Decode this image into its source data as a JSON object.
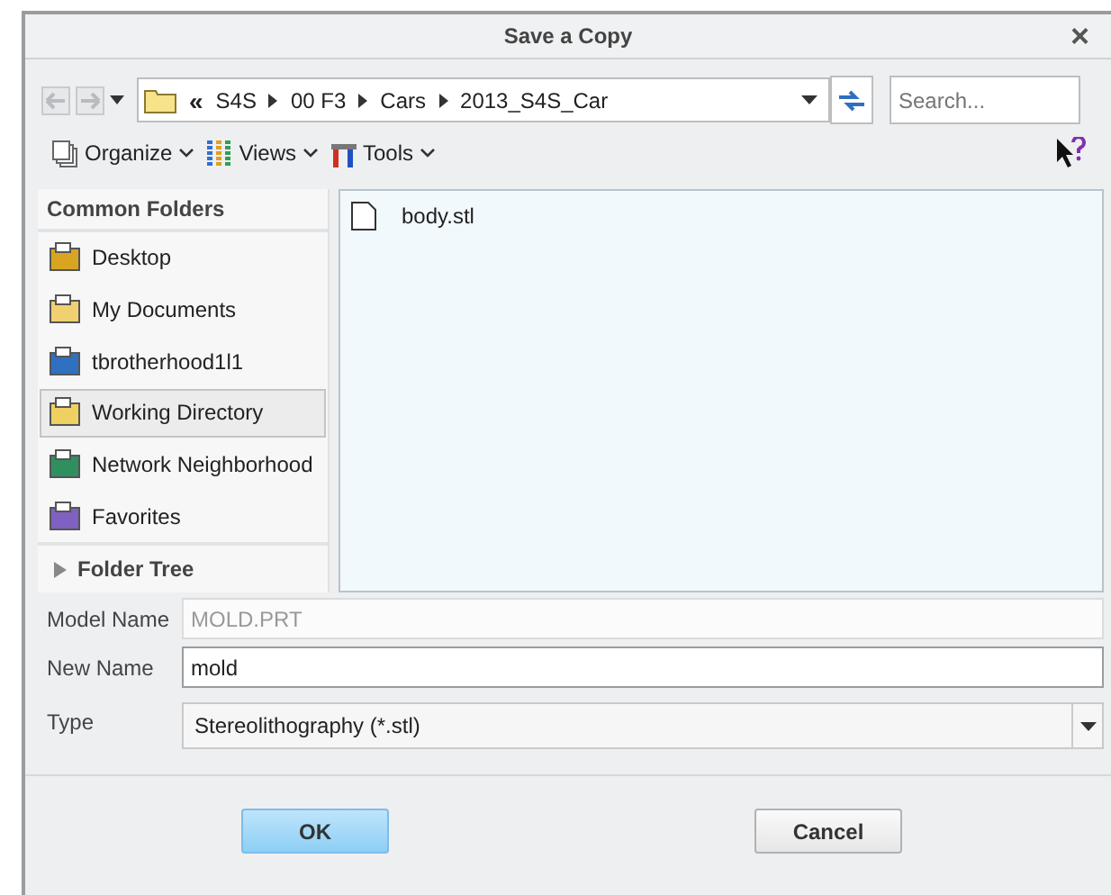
{
  "window": {
    "title": "Save a Copy",
    "close": "×"
  },
  "address": {
    "prefix": "«",
    "crumbs": [
      "S4S",
      "00 F3",
      "Cars",
      "2013_S4S_Car"
    ]
  },
  "search": {
    "placeholder": "Search..."
  },
  "toolbar": [
    {
      "kind": "organize",
      "label": "Organize"
    },
    {
      "kind": "views",
      "label": "Views"
    },
    {
      "kind": "tools",
      "label": "Tools"
    }
  ],
  "sidebar": {
    "title": "Common Folders",
    "items": [
      {
        "kind": "desktop",
        "label": "Desktop",
        "selected": false
      },
      {
        "kind": "documents",
        "label": "My Documents",
        "selected": false
      },
      {
        "kind": "computer",
        "label": "tbrotherhood1l1",
        "selected": false
      },
      {
        "kind": "working",
        "label": "Working Directory",
        "selected": true
      },
      {
        "kind": "network",
        "label": "Network Neighborhood",
        "selected": false
      },
      {
        "kind": "favorites",
        "label": "Favorites",
        "selected": false
      }
    ],
    "folder_tree": {
      "label": "Folder Tree",
      "expanded": false
    }
  },
  "files": [
    {
      "name": "body.stl"
    }
  ],
  "form": [
    {
      "kind": "text",
      "label": "Model Name",
      "value": "MOLD.PRT",
      "disabled": true
    },
    {
      "kind": "text",
      "label": "New Name",
      "value": "mold",
      "disabled": false
    },
    {
      "kind": "select",
      "label": "Type",
      "value": "Stereolithography (*.stl)",
      "disabled": false
    }
  ],
  "buttons": [
    {
      "label": "OK",
      "default": true
    },
    {
      "label": "Cancel",
      "default": false
    }
  ]
}
